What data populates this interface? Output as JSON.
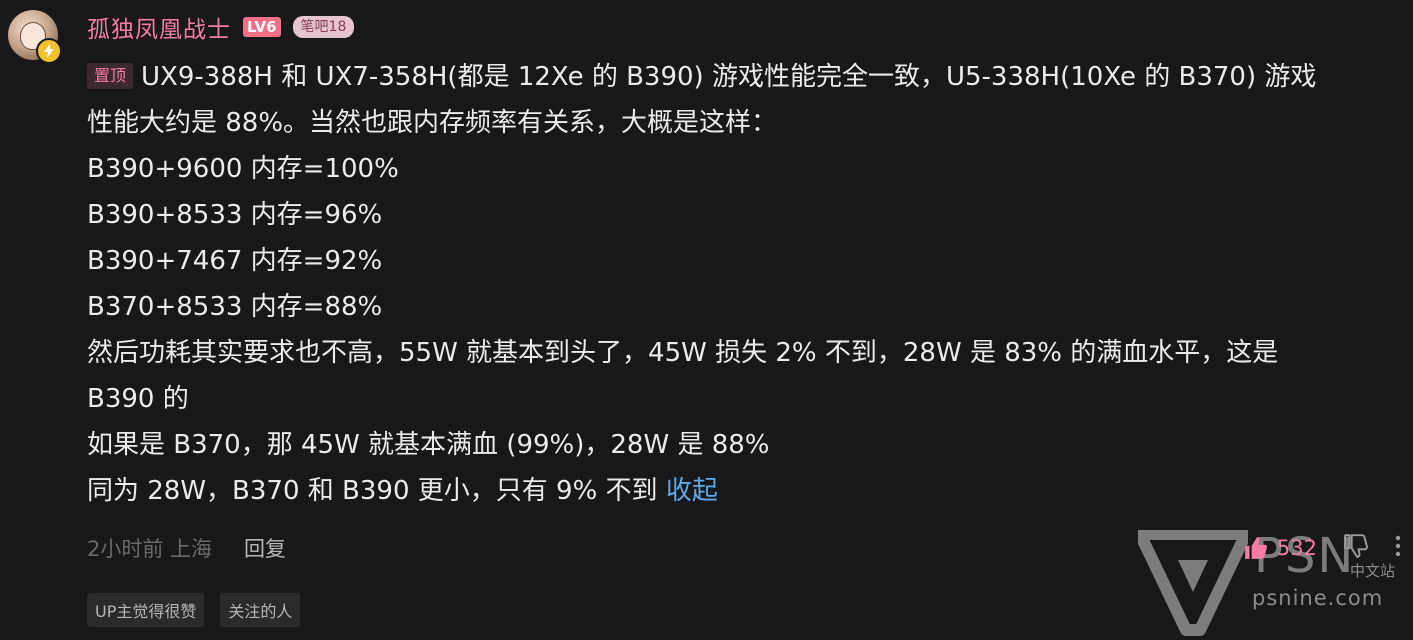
{
  "comment": {
    "username": "孤独凤凰战士",
    "level": "LV6",
    "fan_badge": "笔吧18",
    "pin_label": "置顶",
    "lines": [
      "UX9-388H 和 UX7-358H(都是 12Xe 的 B390) 游戏性能完全一致，U5-338H(10Xe 的 B370) 游戏",
      "性能大约是 88%。当然也跟内存频率有关系，大概是这样：",
      "B390+9600 内存=100%",
      "B390+8533 内存=96%",
      "B390+7467 内存=92%",
      "B370+8533 内存=88%",
      "然后功耗其实要求也不高，55W 就基本到头了，45W 损失 2% 不到，28W 是 83% 的满血水平，这是",
      "B390 的",
      "如果是 B370，那 45W 就基本满血 (99%)，28W 是 88%",
      "同为 28W，B370 和 B390 更小，只有 9% 不到"
    ],
    "collapse_label": "收起",
    "time_location": "2小时前 上海",
    "reply_label": "回复",
    "like_count": "532",
    "tags": [
      "UP主觉得很赞",
      "关注的人"
    ]
  },
  "watermark": {
    "brand": "PSN",
    "subtitle": "中文站",
    "url": "psnine.com"
  },
  "colors": {
    "background": "#18181a",
    "username": "#f47ca5",
    "link": "#5fa9e8",
    "muted": "#6a6a6c"
  }
}
